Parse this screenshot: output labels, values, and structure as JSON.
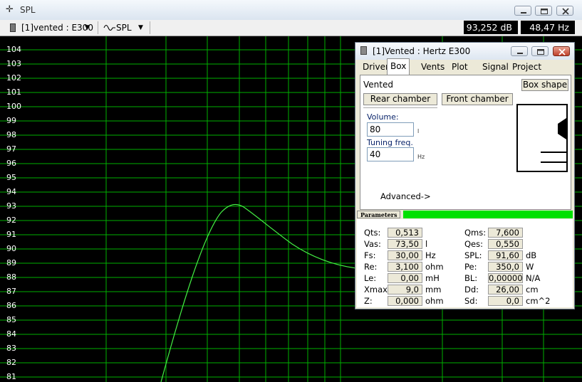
{
  "window": {
    "title": "SPL"
  },
  "toolbar": {
    "project_select": "[1]vented : E300",
    "view_select": "SPL",
    "readout_db": "93,252 dB",
    "readout_hz": "48,47 Hz"
  },
  "plot": {
    "y_ticks": [
      "104",
      "103",
      "102",
      "101",
      "100",
      "99",
      "98",
      "97",
      "96",
      "95",
      "94",
      "93",
      "92",
      "91",
      "90",
      "89",
      "88",
      "87",
      "86",
      "85",
      "84",
      "83",
      "82",
      "81"
    ],
    "grid_color": "#00b000",
    "curve_color": "#44ee44",
    "visible_peak_db": 93.252,
    "visible_peak_hz": 48.47
  },
  "dialog": {
    "title": "[1]Vented : Hertz E300",
    "tabs": [
      "Driver",
      "Box",
      "Vents",
      "Plot",
      "Signal",
      "Project"
    ],
    "active_tab": "Box",
    "box_type": "Vented",
    "box_shape_button": "Box shape",
    "rear_chamber_button": "Rear chamber",
    "front_chamber_button": "Front chamber",
    "volume_label": "Volume:",
    "volume_value": "80",
    "volume_unit": "l",
    "tuning_label": "Tuning freq.",
    "tuning_value": "40",
    "tuning_unit": "Hz",
    "advanced_button": "Advanced->",
    "params_header": "Parameters",
    "params_left": [
      {
        "label": "Qts:",
        "value": "0,513",
        "unit": ""
      },
      {
        "label": "Vas:",
        "value": "73,50",
        "unit": "l"
      },
      {
        "label": "Fs:",
        "value": "30,00",
        "unit": "Hz"
      },
      {
        "label": "Re:",
        "value": "3,100",
        "unit": "ohm"
      },
      {
        "label": "Le:",
        "value": "0,00",
        "unit": "mH"
      },
      {
        "label": "Xmax:",
        "value": "9,0",
        "unit": "mm"
      },
      {
        "label": "Z:",
        "value": "0,000",
        "unit": "ohm"
      }
    ],
    "params_right": [
      {
        "label": "Qms:",
        "value": "7,600",
        "unit": ""
      },
      {
        "label": "Qes:",
        "value": "0,550",
        "unit": ""
      },
      {
        "label": "SPL:",
        "value": "91,60",
        "unit": "dB"
      },
      {
        "label": "Pe:",
        "value": "350,0",
        "unit": "W"
      },
      {
        "label": "BL:",
        "value": "0,00000",
        "unit": "N/A"
      },
      {
        "label": "Dd:",
        "value": "26,00",
        "unit": "cm"
      },
      {
        "label": "Sd:",
        "value": "0,0",
        "unit": "cm^2"
      }
    ]
  }
}
